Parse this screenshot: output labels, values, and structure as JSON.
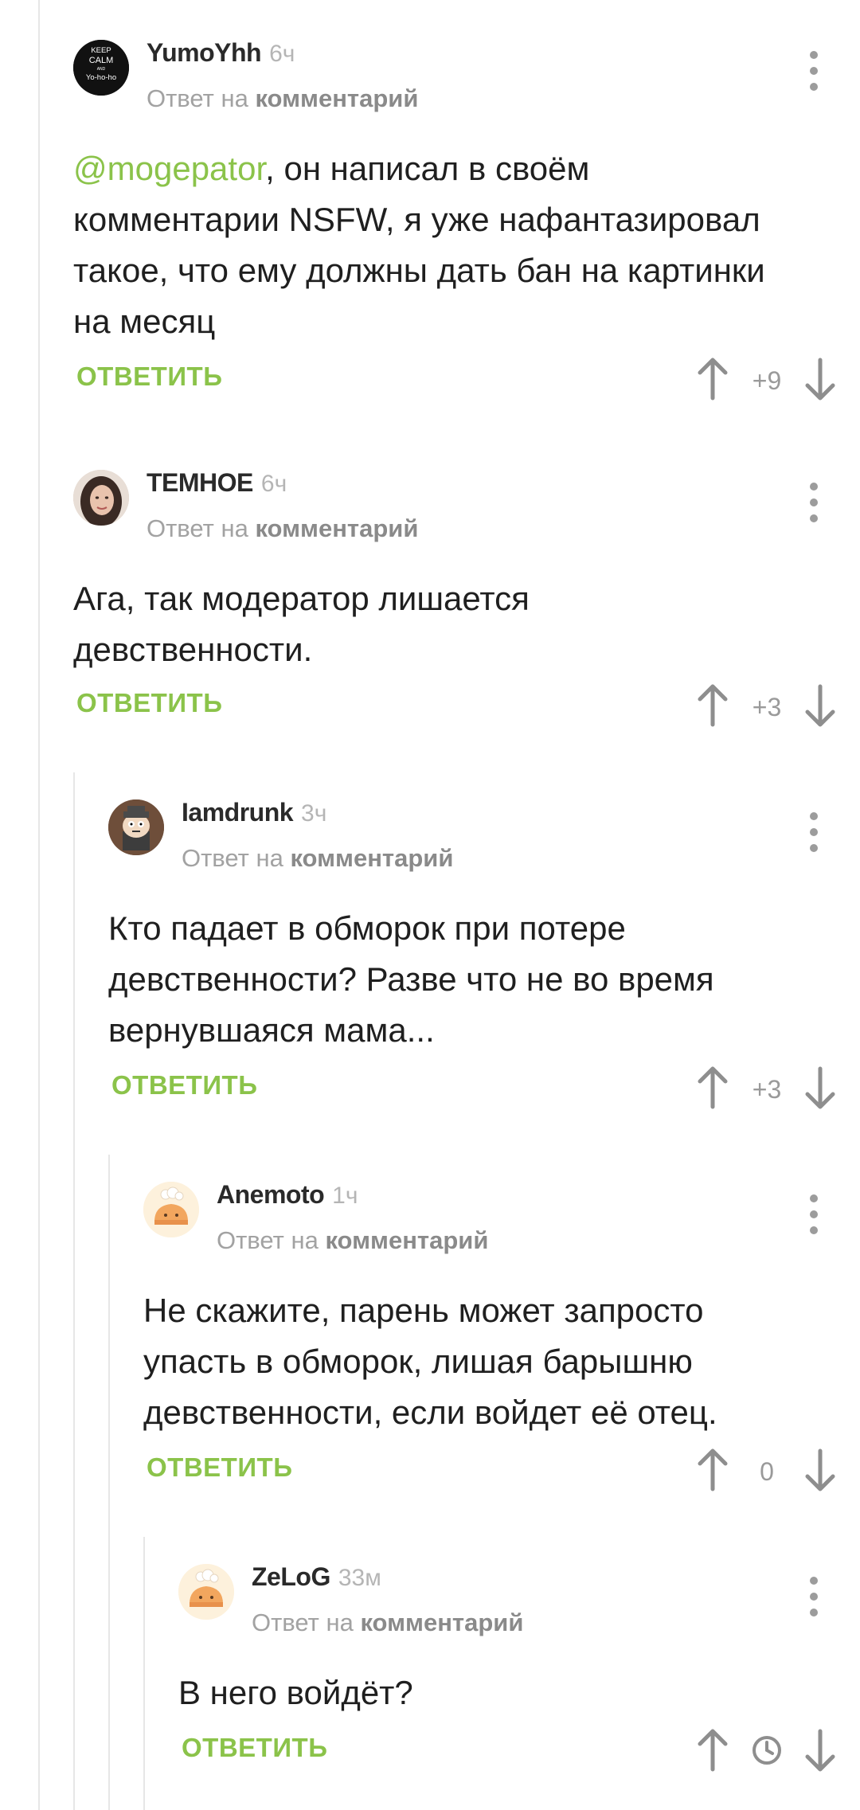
{
  "comments": [
    {
      "author": "YumoYhh",
      "time": "6ч",
      "reply_prefix": "Ответ на",
      "reply_link": "комментарий",
      "mention": "@mogepator",
      "text": ", он написал в своём комментарии NSFW, я уже нафантазировал такое, что ему должны дать бан на картинки на месяц",
      "reply_label": "ОТВЕТИТЬ",
      "score": "+9",
      "avatar_text": [
        "KEEP",
        "CALM",
        "AND",
        "Yo-ho-ho"
      ]
    },
    {
      "author": "ТЕМНОЕ",
      "time": "6ч",
      "reply_prefix": "Ответ на",
      "reply_link": "комментарий",
      "text": "Ага, так модератор лишается девственности.",
      "reply_label": "ОТВЕТИТЬ",
      "score": "+3"
    },
    {
      "author": "Iamdrunk",
      "time": "3ч",
      "reply_prefix": "Ответ на",
      "reply_link": "комментарий",
      "text": "Кто падает в обморок при потере девственности? Разве что не во время вернувшаяся мама...",
      "reply_label": "ОТВЕТИТЬ",
      "score": "+3"
    },
    {
      "author": "Anemoto",
      "time": "1ч",
      "reply_prefix": "Ответ на",
      "reply_link": "комментарий",
      "text": "Не скажите, парень может запросто упасть в обморок, лишая барышню девственности, если войдет её отец.",
      "reply_label": "ОТВЕТИТЬ",
      "score": "0"
    },
    {
      "author": "ZeLoG",
      "time": "33м",
      "reply_prefix": "Ответ на",
      "reply_link": "комментарий",
      "text": "В него войдёт?",
      "reply_label": "ОТВЕТИТЬ",
      "score_state": "clock-icon"
    }
  ],
  "colors": {
    "accent_green": "#8bc34a",
    "muted_text": "#a2a2a2",
    "icon_gray": "#9c9c9c"
  }
}
